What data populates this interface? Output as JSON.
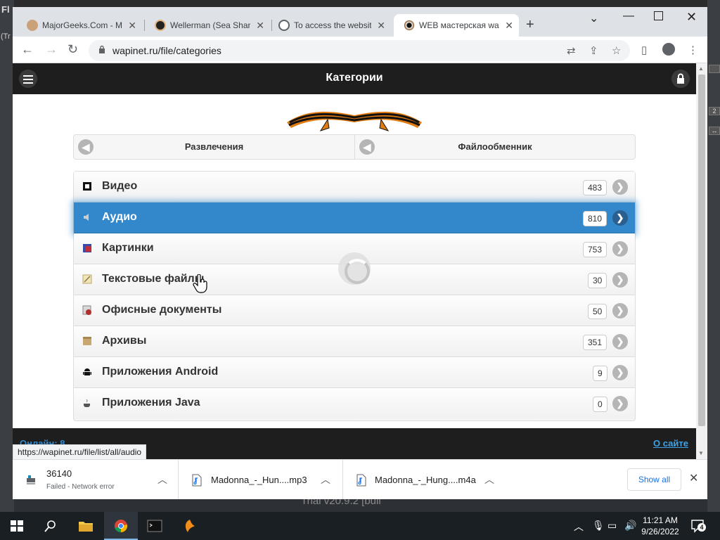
{
  "desktop": {
    "left_label": "Fl",
    "left_label2": "(Tr",
    "background_text": "Trial v20.9.2 [buil"
  },
  "browser": {
    "tabs": [
      {
        "title": "MajorGeeks.Com - M",
        "icon": "majorgeeks-favicon"
      },
      {
        "title": "Wellerman (Sea Shan",
        "icon": "avatar-favicon"
      },
      {
        "title": "To access the website",
        "icon": "globe-favicon"
      },
      {
        "title": "WEB мастерская wap",
        "icon": "eye-favicon",
        "active": true
      }
    ],
    "new_tab": "+",
    "url": "wapinet.ru/file/categories",
    "status_url": "https://wapinet.ru/file/list/all/audio"
  },
  "page": {
    "header_title": "Категории",
    "breadcrumbs": [
      "Развлечения",
      "Файлообменник"
    ],
    "categories": [
      {
        "label": "Видео",
        "count": "483",
        "icon": "film-icon"
      },
      {
        "label": "Аудио",
        "count": "810",
        "icon": "speaker-icon",
        "selected": true
      },
      {
        "label": "Картинки",
        "count": "753",
        "icon": "picture-icon"
      },
      {
        "label": "Текстовые файлы",
        "count": "30",
        "icon": "text-file-icon"
      },
      {
        "label": "Офисные документы",
        "count": "50",
        "icon": "office-doc-icon"
      },
      {
        "label": "Архивы",
        "count": "351",
        "icon": "archive-icon"
      },
      {
        "label": "Приложения Android",
        "count": "9",
        "icon": "android-icon"
      },
      {
        "label": "Приложения Java",
        "count": "0",
        "icon": "java-icon"
      }
    ],
    "footer_online": "Онлайн: 8",
    "footer_about": "О сайте"
  },
  "downloads": [
    {
      "name": "36140",
      "status": "Failed - Network error"
    },
    {
      "name": "Madonna_-_Hun....mp3"
    },
    {
      "name": "Madonna_-_Hung....m4a"
    }
  ],
  "downloads_show_all": "Show all",
  "taskbar": {
    "time": "11:21 AM",
    "date": "9/26/2022",
    "notifications": "4"
  },
  "colors": {
    "accent": "#3388cc",
    "header": "#1e1e1e"
  }
}
